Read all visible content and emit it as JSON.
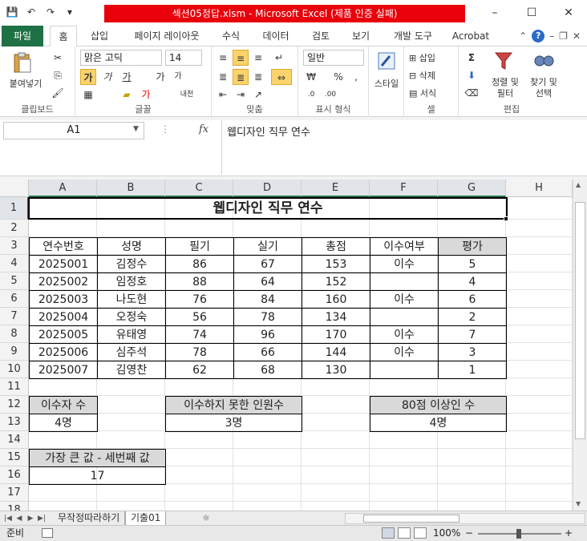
{
  "window": {
    "title": "섹션05정답.xlsm  -  Microsoft Excel (제품 인증 실패)",
    "controls": [
      "–",
      "☐",
      "✕"
    ]
  },
  "qat": [
    "💾",
    "↶",
    "↷",
    "▾"
  ],
  "tabs": [
    "파일",
    "홈",
    "삽입",
    "페이지 레이아웃",
    "수식",
    "데이터",
    "검토",
    "보기",
    "개발 도구",
    "Acrobat"
  ],
  "ribbon": {
    "clipboard": {
      "paste": "붙여넣기",
      "label": "클립보드"
    },
    "font": {
      "name": "맑은 고딕",
      "size": "14",
      "bold": "가",
      "italic": "가",
      "underline": "가",
      "grow": "가",
      "shrink": "가",
      "phonetic": "내천",
      "label": "글꼴"
    },
    "alignment": {
      "label": "맞춤"
    },
    "number": {
      "format": "일반",
      "percent": "%",
      "comma": ",",
      "label": "표시 형식"
    },
    "styles": {
      "button": "스타일"
    },
    "cells": {
      "insert": "삽입",
      "delete": "삭제",
      "format": "서식",
      "label": "셀"
    },
    "editing": {
      "sort": "정렬 및 필터",
      "find": "찾기 및 선택",
      "label": "편집",
      "sum": "Σ"
    }
  },
  "formula_bar": {
    "name_box": "A1",
    "fx": "fx",
    "content": "웹디자인 직무 연수"
  },
  "columns": [
    "A",
    "B",
    "C",
    "D",
    "E",
    "F",
    "G",
    "H"
  ],
  "rows": [
    "1",
    "2",
    "3",
    "4",
    "5",
    "6",
    "7",
    "8",
    "9",
    "10",
    "11",
    "12",
    "13",
    "14",
    "15",
    "16",
    "17",
    "18"
  ],
  "sheet": {
    "title": "웹디자인 직무 연수",
    "headers": [
      "연수번호",
      "성명",
      "필기",
      "실기",
      "총점",
      "이수여부",
      "평가"
    ],
    "data": [
      [
        "2025001",
        "김정수",
        "86",
        "67",
        "153",
        "이수",
        "5"
      ],
      [
        "2025002",
        "임정호",
        "88",
        "64",
        "152",
        "",
        "4"
      ],
      [
        "2025003",
        "나도현",
        "76",
        "84",
        "160",
        "이수",
        "6"
      ],
      [
        "2025004",
        "오정숙",
        "56",
        "78",
        "134",
        "",
        "2"
      ],
      [
        "2025005",
        "유태영",
        "74",
        "96",
        "170",
        "이수",
        "7"
      ],
      [
        "2025006",
        "심주석",
        "78",
        "66",
        "144",
        "이수",
        "3"
      ],
      [
        "2025007",
        "김영찬",
        "62",
        "68",
        "130",
        "",
        "1"
      ]
    ],
    "summary": {
      "pass_label": "이수자 수",
      "pass_value": "4명",
      "fail_label": "이수하지 못한 인원수",
      "fail_value": "3명",
      "over80_label": "80점 이상인 수",
      "over80_value": "4명",
      "third_label": "가장 큰 값 - 세번째 값",
      "third_value": "17"
    }
  },
  "sheet_tabs": [
    "무작정따라하기",
    "기출01"
  ],
  "status": {
    "ready": "준비",
    "zoom": "100%",
    "minus": "−",
    "plus": "+"
  }
}
